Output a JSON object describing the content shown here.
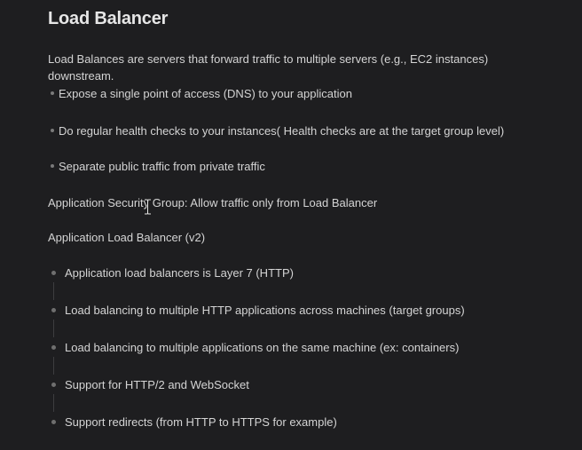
{
  "document": {
    "title": "Load Balancer",
    "intro": "Load Balances are servers that forward traffic to multiple servers (e.g., EC2 instances) downstream.",
    "intro_bullets": [
      "Expose a single point of access (DNS) to your application",
      "Do regular health checks to your instances( Health checks are at the target group level)",
      "Separate public traffic from private traffic"
    ],
    "security_group_note": "Application Security Group: Allow traffic only from Load Balancer",
    "alb_heading": "Application Load Balancer (v2)",
    "alb_bullets": [
      "Application load balancers is Layer 7 (HTTP)",
      "Load balancing to multiple HTTP applications across machines (target groups)",
      "Load balancing to multiple applications on the same machine (ex: containers)",
      "Support for HTTP/2 and WebSocket",
      "Support redirects (from HTTP to HTTPS for example)"
    ]
  },
  "icons": {
    "cursor": "text-cursor-icon"
  }
}
